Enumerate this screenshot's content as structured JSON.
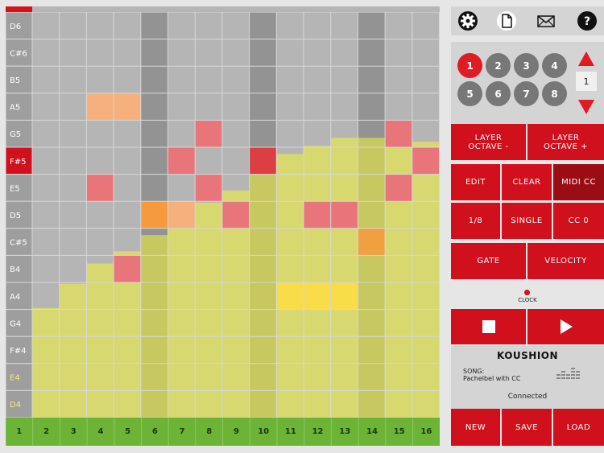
{
  "grid": {
    "notes": [
      "D6",
      "C#6",
      "B5",
      "A5",
      "G5",
      "F#5",
      "E5",
      "D5",
      "C#5",
      "B4",
      "A4",
      "G4",
      "F#4",
      "E4",
      "D4"
    ],
    "steps": [
      "1",
      "2",
      "3",
      "4",
      "5",
      "6",
      "7",
      "8",
      "9",
      "10",
      "11",
      "12",
      "13",
      "14",
      "15",
      "16"
    ],
    "current_step": 1,
    "highlight_columns": [
      5,
      9,
      13
    ],
    "highlight_row_label": 5,
    "notes_on": [
      {
        "note": "A5",
        "step": 3,
        "color": "#f5b07e"
      },
      {
        "note": "A5",
        "step": 4,
        "color": "#f5b07e"
      },
      {
        "note": "G5",
        "step": 7,
        "color": "#e8757a"
      },
      {
        "note": "G5",
        "step": 14,
        "color": "#e8757a"
      },
      {
        "note": "F#5",
        "step": 6,
        "color": "#e8757a"
      },
      {
        "note": "F#5",
        "step": 9,
        "color": "#dc3f43"
      },
      {
        "note": "F#5",
        "step": 15,
        "color": "#e8757a"
      },
      {
        "note": "E5",
        "step": 3,
        "color": "#e8757a"
      },
      {
        "note": "E5",
        "step": 7,
        "color": "#e8757a"
      },
      {
        "note": "E5",
        "step": 14,
        "color": "#e8757a"
      },
      {
        "note": "D5",
        "step": 5,
        "color": "#f59a3e"
      },
      {
        "note": "D5",
        "step": 6,
        "color": "#f5b07e"
      },
      {
        "note": "D5",
        "step": 8,
        "color": "#e8757a"
      },
      {
        "note": "D5",
        "step": 11,
        "color": "#e8757a"
      },
      {
        "note": "D5",
        "step": 12,
        "color": "#e8757a"
      },
      {
        "note": "D5",
        "step": 16,
        "color": "#e8757a"
      },
      {
        "note": "C#5",
        "step": 13,
        "color": "#f0a040"
      },
      {
        "note": "B4",
        "step": 4,
        "color": "#e8757a"
      },
      {
        "note": "A4",
        "step": 10,
        "color": "#f8dc4a"
      },
      {
        "note": "A4",
        "step": 11,
        "color": "#f8dc4a"
      },
      {
        "note": "A4",
        "step": 12,
        "color": "#f8dc4a"
      }
    ],
    "cc_levels": [
      0.27,
      0.33,
      0.38,
      0.41,
      0.45,
      0.5,
      0.53,
      0.56,
      0.62,
      0.65,
      0.67,
      0.69,
      0.69,
      0.69,
      0.68,
      0.66
    ],
    "colors": {
      "cell": "#b5b5b5",
      "cell_highlight": "#939393",
      "label_bg": "#9e9e9e",
      "label_active": "#d0101c",
      "cc_fill": "#d8d870",
      "cc_fill_highlight": "#c8c860",
      "step_bar": "#6cb338",
      "grid_line": "#d8d8d8"
    }
  },
  "toolbar": {
    "icons": [
      "gear-icon",
      "file-icon",
      "mail-icon",
      "help-icon"
    ],
    "help_label": "?"
  },
  "channels": {
    "items": [
      "1",
      "2",
      "3",
      "4",
      "5",
      "6",
      "7",
      "8"
    ],
    "selected": "1",
    "value": "1"
  },
  "buttons": {
    "layer_octave_down": "LAYER\nOCTAVE -",
    "layer_octave_up": "LAYER\nOCTAVE +",
    "edit": "EDIT",
    "clear": "CLEAR",
    "midi_cc": "MIDI CC",
    "note_length": "1/8",
    "single": "SINGLE",
    "cc_value": "CC 0",
    "gate": "GATE",
    "velocity": "VELOCITY",
    "new": "NEW",
    "save": "SAVE",
    "load": "LOAD"
  },
  "clock": {
    "label": "CLOCK"
  },
  "info": {
    "app_title": "KOUSHION",
    "song_label": "SONG:",
    "song_name": "Pachelbel with CC",
    "status": "Connected"
  },
  "accent": "#d0101c"
}
